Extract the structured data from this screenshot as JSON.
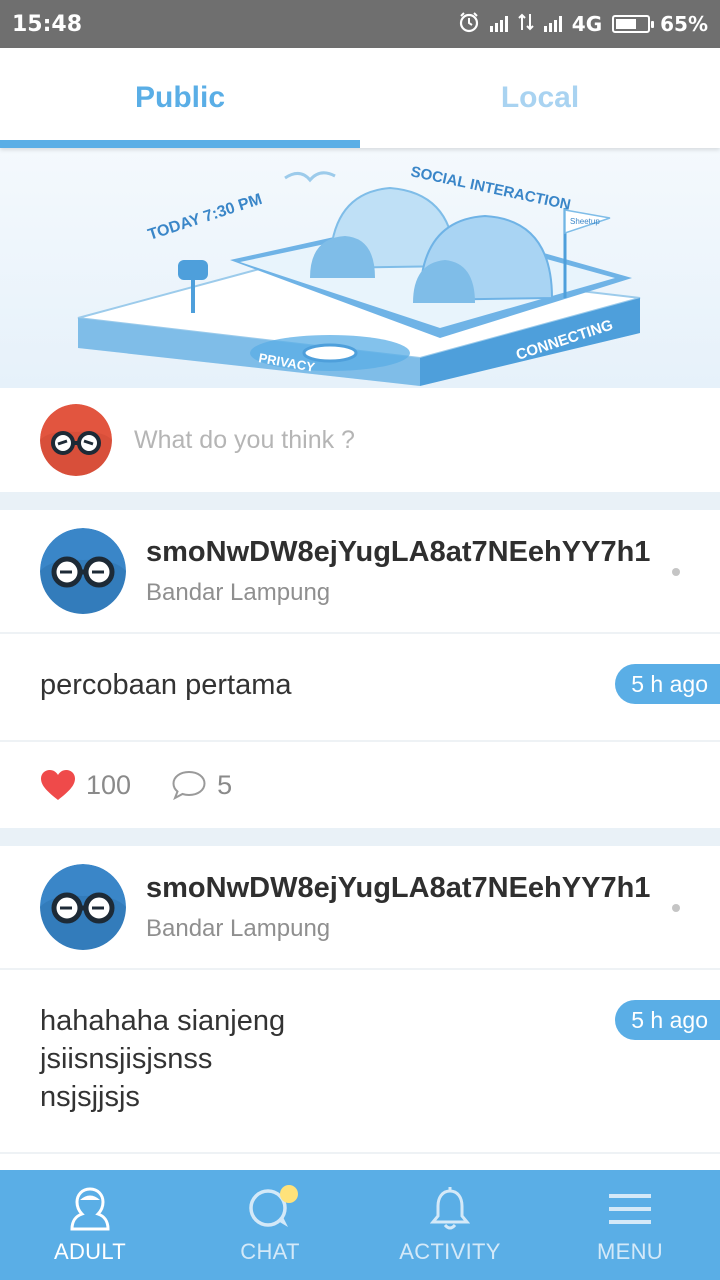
{
  "status_bar": {
    "time": "15:48",
    "network": "4G",
    "battery": "65%",
    "battery_level": 0.65,
    "icons": [
      "alarm-icon",
      "signal-icon",
      "data-transfer-icon",
      "signal-icon",
      "battery-icon"
    ]
  },
  "tabs": [
    {
      "label": "Public",
      "active": true
    },
    {
      "label": "Local",
      "active": false
    }
  ],
  "banner": {
    "texts": [
      "SOCIAL INTERACTION",
      "TODAY 7:30 PM",
      "CONNECTING",
      "PRIVACY",
      "Sheetup"
    ]
  },
  "composer": {
    "placeholder": "What do you think ?"
  },
  "posts": [
    {
      "user": "smoNwDW8ejYugLA8at7NEehYY7h1",
      "location": "Bandar Lampung",
      "text": "percobaan pertama",
      "time": "5 h ago",
      "likes": "100",
      "comments": "5"
    },
    {
      "user": "smoNwDW8ejYugLA8at7NEehYY7h1",
      "location": "Bandar Lampung",
      "text": "hahahaha sianjeng\njsiisnsjisjsnss\nnsjsjjsjs",
      "time": "5 h ago"
    }
  ],
  "bottom_nav": [
    {
      "label": "ADULT",
      "icon": "user-silhouette-icon",
      "active": true
    },
    {
      "label": "CHAT",
      "icon": "chat-bubble-icon",
      "active": false
    },
    {
      "label": "ACTIVITY",
      "icon": "bell-icon",
      "active": false
    },
    {
      "label": "MENU",
      "icon": "hamburger-menu-icon",
      "active": false
    }
  ],
  "colors": {
    "accent": "#5aaee6",
    "tab_inactive": "#a9d3f1",
    "like_heart": "#ef4a4a",
    "avatar_orange": "#e2553f",
    "avatar_blue": "#3a86c8"
  }
}
